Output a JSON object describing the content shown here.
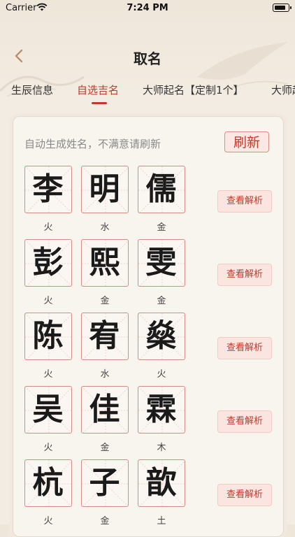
{
  "status_bar": {
    "carrier": "Carrier",
    "time": "7:24 PM"
  },
  "header": {
    "title": "取名"
  },
  "tabs": [
    {
      "label": "生辰信息",
      "active": false
    },
    {
      "label": "自选吉名",
      "active": true
    },
    {
      "label": "大师起名【定制1个】",
      "active": false
    },
    {
      "label": "大师起",
      "active": false
    }
  ],
  "card": {
    "hint": "自动生成姓名，不满意请刷新",
    "refresh_label": "刷新",
    "analyze_label": "查看解析",
    "names": [
      {
        "chars": [
          {
            "char": "李",
            "element": "火"
          },
          {
            "char": "明",
            "element": "水"
          },
          {
            "char": "儒",
            "element": "金"
          }
        ]
      },
      {
        "chars": [
          {
            "char": "彭",
            "element": "火"
          },
          {
            "char": "熙",
            "element": "金"
          },
          {
            "char": "雯",
            "element": "金"
          }
        ]
      },
      {
        "chars": [
          {
            "char": "陈",
            "element": "火"
          },
          {
            "char": "宥",
            "element": "水"
          },
          {
            "char": "燊",
            "element": "火"
          }
        ]
      },
      {
        "chars": [
          {
            "char": "吴",
            "element": "火"
          },
          {
            "char": "佳",
            "element": "金"
          },
          {
            "char": "霖",
            "element": "木"
          }
        ]
      },
      {
        "chars": [
          {
            "char": "杭",
            "element": "火"
          },
          {
            "char": "子",
            "element": "金"
          },
          {
            "char": "歆",
            "element": "土"
          }
        ]
      }
    ]
  },
  "colors": {
    "accent": "#c23a2b",
    "background": "#f3ece2",
    "box_border": "#d58c85"
  },
  "icons": {
    "back": "chevron-left-icon",
    "wifi": "wifi-icon",
    "battery": "battery-icon"
  }
}
